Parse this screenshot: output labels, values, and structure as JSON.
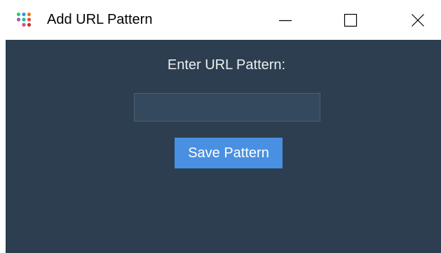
{
  "window": {
    "title": "Add URL Pattern",
    "app_icon": "colored-dots-app-icon",
    "controls": {
      "minimize_icon": "minimize-icon",
      "maximize_icon": "maximize-icon",
      "close_icon": "close-icon"
    }
  },
  "dialog": {
    "prompt_label": "Enter URL Pattern:",
    "input": {
      "value": "",
      "placeholder": ""
    },
    "save_button_label": "Save Pattern"
  },
  "colors": {
    "background": "#2c3e50",
    "input_background": "#34495e",
    "button": "#4a90e2",
    "text": "#ecf0f1"
  }
}
